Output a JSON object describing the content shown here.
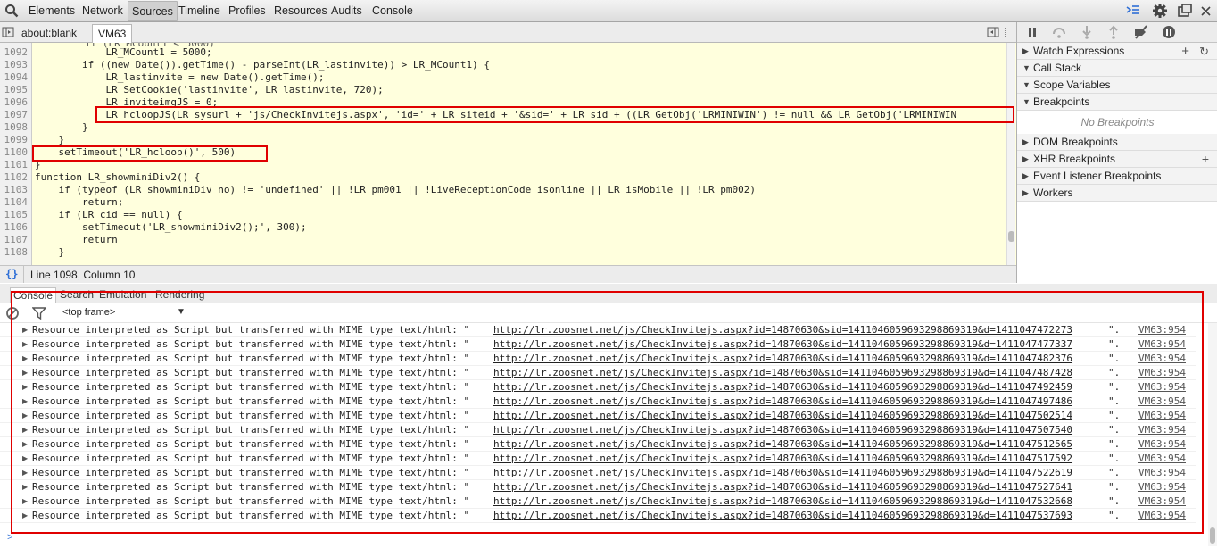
{
  "toolbar": {
    "tabs": [
      "Elements",
      "Network",
      "Sources",
      "Timeline",
      "Profiles",
      "Resources",
      "Audits",
      "Console"
    ],
    "active_tab": "Sources"
  },
  "sources": {
    "file_tabs": [
      "about:blank",
      "VM63"
    ],
    "active_file": "VM63",
    "status": "Line 1098, Column 10",
    "status_icon": "{}"
  },
  "code_lines": [
    {
      "n": "1092",
      "t": "            LR_MCount1 = 5000;"
    },
    {
      "n": "1093",
      "t": "        if ((new Date()).getTime() - parseInt(LR_lastinvite)) > LR_MCount1) {"
    },
    {
      "n": "1094",
      "t": "            LR_lastinvite = new Date().getTime();"
    },
    {
      "n": "1095",
      "t": "            LR_SetCookie('lastinvite', LR_lastinvite, 720);"
    },
    {
      "n": "1096",
      "t": "            LR_inviteimgJS = 0;"
    },
    {
      "n": "1097",
      "t": "            LR_hcloopJS(LR_sysurl + 'js/CheckInvitejs.aspx', 'id=' + LR_siteid + '&sid=' + LR_sid + ((LR_GetObj('LRMINIWIN') != null && LR_GetObj('LRMINIWIN"
    },
    {
      "n": "1098",
      "t": "        }"
    },
    {
      "n": "1099",
      "t": "    }"
    },
    {
      "n": "1100",
      "t": "    setTimeout('LR_hcloop()', 500)"
    },
    {
      "n": "1101",
      "t": "}"
    },
    {
      "n": "1102",
      "t": "function LR_showminiDiv2() {"
    },
    {
      "n": "1103",
      "t": "    if (typeof (LR_showminiDiv_no) != 'undefined' || !LR_pm001 || !LiveReceptionCode_isonline || LR_isMobile || !LR_pm002)"
    },
    {
      "n": "1104",
      "t": "        return;"
    },
    {
      "n": "1105",
      "t": "    if (LR_cid == null) {"
    },
    {
      "n": "1106",
      "t": "        setTimeout('LR_showminiDiv2();', 300);"
    },
    {
      "n": "1107",
      "t": "        return"
    },
    {
      "n": "1108",
      "t": "    }"
    }
  ],
  "sidebar": {
    "sections": [
      {
        "label": "Watch Expressions",
        "open": false,
        "actions": [
          "+",
          "refresh"
        ]
      },
      {
        "label": "Call Stack",
        "open": true
      },
      {
        "label": "Scope Variables",
        "open": true
      },
      {
        "label": "Breakpoints",
        "open": true
      }
    ],
    "empty_breakpoints": "No Breakpoints",
    "more_sections": [
      {
        "label": "DOM Breakpoints",
        "add": false
      },
      {
        "label": "XHR Breakpoints",
        "add": true
      },
      {
        "label": "Event Listener Breakpoints",
        "add": false
      },
      {
        "label": "Workers",
        "add": false
      }
    ]
  },
  "drawer": {
    "tabs": [
      "Console",
      "Search",
      "Emulation",
      "Rendering"
    ],
    "active_tab": "Console",
    "frame_select": "<top frame>"
  },
  "console": {
    "message_text": "Resource interpreted as Script but transferred with MIME type text/html: \"",
    "source": "VM63:954",
    "urls": [
      "http://lr.zoosnet.net/js/CheckInvitejs.aspx?id=14870630&sid=1411046059693298869319&d=1411047472273",
      "http://lr.zoosnet.net/js/CheckInvitejs.aspx?id=14870630&sid=1411046059693298869319&d=1411047477337",
      "http://lr.zoosnet.net/js/CheckInvitejs.aspx?id=14870630&sid=1411046059693298869319&d=1411047482376",
      "http://lr.zoosnet.net/js/CheckInvitejs.aspx?id=14870630&sid=1411046059693298869319&d=1411047487428",
      "http://lr.zoosnet.net/js/CheckInvitejs.aspx?id=14870630&sid=1411046059693298869319&d=1411047492459",
      "http://lr.zoosnet.net/js/CheckInvitejs.aspx?id=14870630&sid=1411046059693298869319&d=1411047497486",
      "http://lr.zoosnet.net/js/CheckInvitejs.aspx?id=14870630&sid=1411046059693298869319&d=1411047502514",
      "http://lr.zoosnet.net/js/CheckInvitejs.aspx?id=14870630&sid=1411046059693298869319&d=1411047507540",
      "http://lr.zoosnet.net/js/CheckInvitejs.aspx?id=14870630&sid=1411046059693298869319&d=1411047512565",
      "http://lr.zoosnet.net/js/CheckInvitejs.aspx?id=14870630&sid=1411046059693298869319&d=1411047517592",
      "http://lr.zoosnet.net/js/CheckInvitejs.aspx?id=14870630&sid=1411046059693298869319&d=1411047522619",
      "http://lr.zoosnet.net/js/CheckInvitejs.aspx?id=14870630&sid=1411046059693298869319&d=1411047527641",
      "http://lr.zoosnet.net/js/CheckInvitejs.aspx?id=14870630&sid=1411046059693298869319&d=1411047532668",
      "http://lr.zoosnet.net/js/CheckInvitejs.aspx?id=14870630&sid=1411046059693298869319&d=1411047537693"
    ],
    "url_suffix": "\".",
    "prompt": ">"
  },
  "colors": {
    "highlight_box": "#e00000",
    "code_background": "#ffffdd"
  }
}
